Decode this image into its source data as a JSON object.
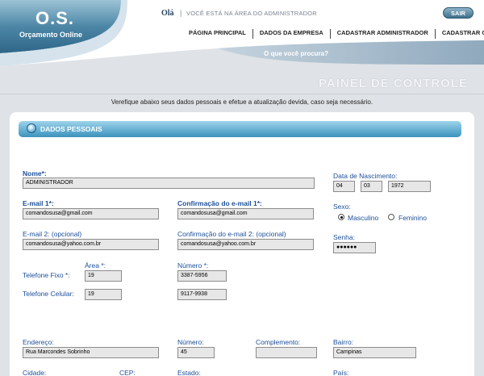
{
  "brand": {
    "title": "O.S.",
    "subtitle": "Orçamento Online"
  },
  "header": {
    "greeting": "Olá",
    "separator": "|",
    "message": "VOCÊ ESTÁ NA ÁREA DO ADMINISTRADOR",
    "logout_label": "SAIR",
    "nav": [
      "PÁGINA PRINCIPAL",
      "DADOS DA EMPRESA",
      "CADASTRAR ADMINISTRADOR",
      "CADASTRAR O.S."
    ],
    "search_label": "O que você procura?"
  },
  "panel": {
    "title": "PAINEL DE CONTROLE",
    "intro": "Verefique abaixo seus dados pessoais e efetue a atualização devida, caso seja necessário."
  },
  "section": {
    "title": "DADOS PESSOAIS"
  },
  "form": {
    "nome": {
      "label": "Nome*:",
      "value": "ADMINISTRADOR"
    },
    "nascimento": {
      "label": "Data de Nascimento:",
      "day": "04",
      "month": "03",
      "year": "1972"
    },
    "email1": {
      "label": "E-mail 1*:",
      "value": "comandosusa@gmail.com"
    },
    "email1_confirm": {
      "label": "Confirmação do e-mail 1*:",
      "value": "comandosusa@gmail.com"
    },
    "sexo": {
      "label": "Sexo:",
      "options": [
        "Masculino",
        "Feminino"
      ],
      "selected": "Masculino"
    },
    "email2": {
      "label": "E-mail 2: (opcional)",
      "value": "comandosusa@yahoo.com.br"
    },
    "email2_confirm": {
      "label": "Confirmação do e-mail 2: (opcional)",
      "value": "comandosusa@yahoo.com.br"
    },
    "senha": {
      "label": "Senha:",
      "value": "●●●●●●"
    },
    "area_label": "Área *:",
    "numero_label": "Número *:",
    "telefone_fixo": {
      "label": "Telefone Fixo *:",
      "area": "19",
      "numero": "3387-5956"
    },
    "telefone_celular": {
      "label": "Telefone Celular:",
      "area": "19",
      "numero": "9117-9938"
    },
    "endereco": {
      "label": "Endereço:",
      "value": "Rua Marcondes Sobrinho"
    },
    "numero": {
      "label": "Número:",
      "value": "45"
    },
    "complemento": {
      "label": "Complemento:",
      "value": ""
    },
    "bairro": {
      "label": "Bairro:",
      "value": "Campinas"
    },
    "cidade_label": "Cidade:",
    "cep_label": "CEP:",
    "estado_label": "Estado:",
    "pais_label": "País:"
  }
}
